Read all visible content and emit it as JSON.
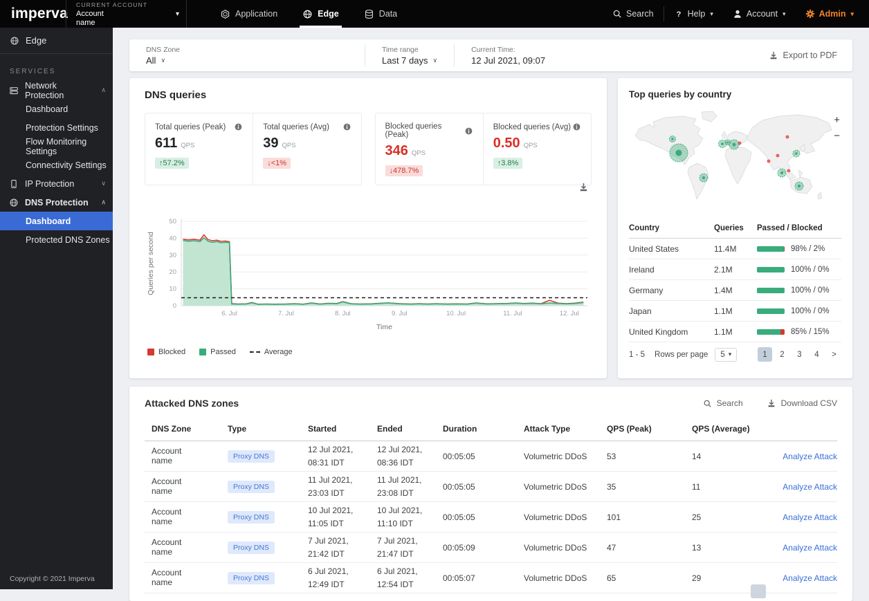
{
  "topbar": {
    "logo": "imperva",
    "current_account_label": "CURRENT ACCOUNT",
    "account_name": "Account name",
    "tabs": [
      {
        "label": "Application",
        "icon": "application",
        "active": false
      },
      {
        "label": "Edge",
        "icon": "edge",
        "active": true
      },
      {
        "label": "Data",
        "icon": "data",
        "active": false
      }
    ],
    "search_label": "Search",
    "help_label": "Help",
    "account_label": "Account",
    "admin_label": "Admin",
    "admin_color": "#f0832a"
  },
  "sidebar": {
    "product_label": "Edge",
    "services_label": "SERVICES",
    "items": [
      {
        "label": "Network Protection",
        "icon": "network",
        "expanded": true,
        "bold": false,
        "children": [
          {
            "label": "Dashboard",
            "active": false
          },
          {
            "label": "Protection Settings",
            "active": false
          },
          {
            "label": "Flow Monitoring Settings",
            "active": false
          },
          {
            "label": "Connectivity Settings",
            "active": false
          }
        ]
      },
      {
        "label": "IP Protection",
        "icon": "phone",
        "expanded": false,
        "bold": false,
        "children": []
      },
      {
        "label": "DNS Protection",
        "icon": "globe",
        "expanded": true,
        "bold": true,
        "children": [
          {
            "label": "Dashboard",
            "active": true
          },
          {
            "label": "Protected DNS Zones",
            "active": false
          }
        ]
      }
    ],
    "active_color": "#3a6bd4",
    "copyright": "Copyright © 2021 Imperva"
  },
  "filters": {
    "dns_zone_label": "DNS Zone",
    "dns_zone_value": "All",
    "time_range_label": "Time range",
    "time_range_value": "Last 7 days",
    "current_time_label": "Current Time:",
    "current_time_value": "12 Jul 2021, 09:07",
    "export_label": "Export to PDF"
  },
  "dns_queries": {
    "title": "DNS queries",
    "stat_groups": [
      [
        {
          "label": "Total queries (Peak)",
          "value": "611",
          "unit": "QPS",
          "value_color": "#212326",
          "badge": "↑57.2%",
          "badge_type": "green"
        },
        {
          "label": "Total queries (Avg)",
          "value": "39",
          "unit": "QPS",
          "value_color": "#212326",
          "badge": "↓<1%",
          "badge_type": "red"
        }
      ],
      [
        {
          "label": "Blocked queries (Peak)",
          "value": "346",
          "unit": "QPS",
          "value_color": "#d92f25",
          "badge": "↓478.7%",
          "badge_type": "red"
        },
        {
          "label": "Blocked queries (Avg)",
          "value": "0.50",
          "unit": "QPS",
          "value_color": "#d92f25",
          "badge": "↑3.8%",
          "badge_type": "green"
        }
      ]
    ],
    "legend": [
      {
        "label": "Blocked",
        "swatch": "#d6392e"
      },
      {
        "label": "Passed",
        "swatch": "#3aac7c"
      },
      {
        "label": "Average",
        "swatch": "dashed"
      }
    ]
  },
  "chart_data": {
    "type": "area",
    "title": "DNS queries",
    "xlabel": "Time",
    "ylabel": "Queries per second",
    "ylim": [
      0,
      50
    ],
    "yticks": [
      0,
      10,
      20,
      30,
      40,
      50
    ],
    "xlim": [
      5.15,
      12.32
    ],
    "xticks": [
      {
        "pos": 6,
        "label": "6. Jul"
      },
      {
        "pos": 7,
        "label": "7. Jul"
      },
      {
        "pos": 8,
        "label": "8. Jul"
      },
      {
        "pos": 9,
        "label": "9. Jul"
      },
      {
        "pos": 10,
        "label": "10. Jul"
      },
      {
        "pos": 11,
        "label": "11. Jul"
      },
      {
        "pos": 12,
        "label": "12. Jul"
      }
    ],
    "average": 4.7,
    "grid": true,
    "legend_position": "bottom",
    "series": [
      {
        "name": "Blocked",
        "color": "#d6392e",
        "points": [
          [
            5.18,
            39.4
          ],
          [
            5.28,
            39.0
          ],
          [
            5.38,
            39.3
          ],
          [
            5.48,
            38.8
          ],
          [
            5.55,
            42.0
          ],
          [
            5.62,
            39.2
          ],
          [
            5.7,
            38.5
          ],
          [
            5.78,
            38.8
          ],
          [
            5.85,
            38.1
          ],
          [
            5.93,
            38.3
          ],
          [
            6.0,
            37.9
          ],
          [
            6.04,
            1.2
          ],
          [
            6.15,
            1.0
          ],
          [
            6.3,
            1.1
          ],
          [
            6.4,
            1.9
          ],
          [
            6.5,
            0.9
          ],
          [
            6.65,
            1.0
          ],
          [
            6.8,
            0.9
          ],
          [
            7.0,
            1.0
          ],
          [
            7.15,
            1.2
          ],
          [
            7.3,
            0.9
          ],
          [
            7.45,
            1.6
          ],
          [
            7.6,
            1.0
          ],
          [
            7.75,
            1.4
          ],
          [
            7.9,
            1.3
          ],
          [
            8.0,
            2.4
          ],
          [
            8.15,
            1.2
          ],
          [
            8.3,
            1.0
          ],
          [
            8.5,
            1.1
          ],
          [
            8.65,
            1.4
          ],
          [
            8.8,
            1.7
          ],
          [
            9.0,
            1.2
          ],
          [
            9.2,
            1.0
          ],
          [
            9.35,
            1.2
          ],
          [
            9.5,
            1.0
          ],
          [
            9.65,
            1.2
          ],
          [
            9.85,
            1.0
          ],
          [
            10.0,
            1.1
          ],
          [
            10.2,
            1.0
          ],
          [
            10.35,
            1.6
          ],
          [
            10.55,
            1.1
          ],
          [
            10.7,
            1.2
          ],
          [
            10.9,
            1.3
          ],
          [
            11.05,
            1.6
          ],
          [
            11.2,
            1.3
          ],
          [
            11.35,
            1.5
          ],
          [
            11.5,
            1.2
          ],
          [
            11.65,
            3.2
          ],
          [
            11.8,
            1.5
          ],
          [
            11.95,
            1.2
          ],
          [
            12.1,
            1.5
          ],
          [
            12.25,
            2.1
          ]
        ]
      },
      {
        "name": "Passed",
        "color": "#3aac7c",
        "fill": "#c2e5d2",
        "points": [
          [
            5.18,
            38.6
          ],
          [
            5.28,
            38.2
          ],
          [
            5.38,
            38.5
          ],
          [
            5.48,
            37.9
          ],
          [
            5.55,
            40.3
          ],
          [
            5.62,
            38.2
          ],
          [
            5.7,
            37.6
          ],
          [
            5.78,
            38.0
          ],
          [
            5.85,
            37.3
          ],
          [
            5.93,
            37.6
          ],
          [
            6.0,
            37.4
          ],
          [
            6.04,
            1.0
          ],
          [
            6.15,
            0.9
          ],
          [
            6.3,
            1.0
          ],
          [
            6.4,
            1.7
          ],
          [
            6.5,
            0.8
          ],
          [
            6.65,
            0.9
          ],
          [
            6.8,
            0.8
          ],
          [
            7.0,
            0.9
          ],
          [
            7.15,
            1.1
          ],
          [
            7.3,
            0.8
          ],
          [
            7.45,
            1.5
          ],
          [
            7.6,
            0.9
          ],
          [
            7.75,
            1.3
          ],
          [
            7.9,
            1.2
          ],
          [
            8.0,
            2.2
          ],
          [
            8.15,
            1.1
          ],
          [
            8.3,
            0.9
          ],
          [
            8.5,
            1.0
          ],
          [
            8.65,
            1.3
          ],
          [
            8.8,
            1.6
          ],
          [
            9.0,
            1.1
          ],
          [
            9.2,
            0.9
          ],
          [
            9.35,
            1.1
          ],
          [
            9.5,
            0.9
          ],
          [
            9.65,
            1.1
          ],
          [
            9.85,
            0.9
          ],
          [
            10.0,
            1.0
          ],
          [
            10.2,
            0.9
          ],
          [
            10.35,
            1.5
          ],
          [
            10.55,
            1.0
          ],
          [
            10.7,
            1.1
          ],
          [
            10.9,
            1.2
          ],
          [
            11.05,
            1.5
          ],
          [
            11.2,
            1.2
          ],
          [
            11.35,
            1.4
          ],
          [
            11.5,
            1.1
          ],
          [
            11.65,
            1.6
          ],
          [
            11.8,
            1.3
          ],
          [
            11.95,
            1.1
          ],
          [
            12.1,
            1.3
          ],
          [
            12.25,
            1.9
          ]
        ]
      }
    ]
  },
  "top_countries": {
    "title": "Top queries by country",
    "map": {
      "zoom_in": "+",
      "zoom_out": "−",
      "passed_color": "#3daa7b",
      "blocked_color": "#e25549",
      "bubbles": [
        {
          "country": "Canada",
          "x": 62,
          "y": 43,
          "r": 4.5,
          "type": "passed"
        },
        {
          "country": "United States",
          "x": 71,
          "y": 63,
          "r": 13,
          "type": "passed"
        },
        {
          "country": "Brazil",
          "x": 107,
          "y": 99,
          "r": 6,
          "type": "passed"
        },
        {
          "country": "Ireland",
          "x": 134,
          "y": 50,
          "r": 5.5,
          "type": "passed"
        },
        {
          "country": "United Kingdom",
          "x": 142,
          "y": 48,
          "r": 4,
          "type": "passed"
        },
        {
          "country": "Germany",
          "x": 151,
          "y": 51,
          "r": 7,
          "type": "passed"
        },
        {
          "country": "Poland",
          "x": 159,
          "y": 49,
          "r": 2.5,
          "type": "blocked"
        },
        {
          "country": "Russia",
          "x": 228,
          "y": 40,
          "r": 2.5,
          "type": "blocked"
        },
        {
          "country": "China",
          "x": 214,
          "y": 67,
          "r": 2.5,
          "type": "blocked"
        },
        {
          "country": "India",
          "x": 201,
          "y": 75,
          "r": 2.5,
          "type": "blocked"
        },
        {
          "country": "Japan",
          "x": 241,
          "y": 64,
          "r": 5,
          "type": "passed"
        },
        {
          "country": "Philippines",
          "x": 230,
          "y": 89,
          "r": 2.5,
          "type": "blocked"
        },
        {
          "country": "Malaysia",
          "x": 220,
          "y": 92,
          "r": 6,
          "type": "passed"
        },
        {
          "country": "Australia",
          "x": 245,
          "y": 111,
          "r": 6,
          "type": "passed"
        }
      ]
    },
    "table": {
      "headers": [
        "Country",
        "Queries",
        "Passed / Blocked"
      ],
      "rows": [
        {
          "country": "United States",
          "queries": "11.4M",
          "passed_pct": 98,
          "blocked_pct": 2,
          "label": "98% / 2%"
        },
        {
          "country": "Ireland",
          "queries": "2.1M",
          "passed_pct": 100,
          "blocked_pct": 0,
          "label": "100% / 0%"
        },
        {
          "country": "Germany",
          "queries": "1.4M",
          "passed_pct": 100,
          "blocked_pct": 0,
          "label": "100% / 0%"
        },
        {
          "country": "Japan",
          "queries": "1.1M",
          "passed_pct": 100,
          "blocked_pct": 0,
          "label": "100% / 0%"
        },
        {
          "country": "United Kingdom",
          "queries": "1.1M",
          "passed_pct": 85,
          "blocked_pct": 15,
          "label": "85% / 15%"
        }
      ]
    },
    "pagination": {
      "range": "1 - 5",
      "rows_label": "Rows per page",
      "rows_value": "5",
      "pages": [
        "1",
        "2",
        "3",
        "4"
      ],
      "active_page": "1",
      "next": ">"
    }
  },
  "attacked_zones": {
    "title": "Attacked DNS zones",
    "search_label": "Search",
    "download_label": "Download CSV",
    "headers": [
      "DNS Zone",
      "Type",
      "Started",
      "Ended",
      "Duration",
      "Attack Type",
      "QPS (Peak)",
      "QPS (Average)",
      ""
    ],
    "rows": [
      {
        "zone": "Account name",
        "type": "Proxy DNS",
        "started_date": "12 Jul 2021,",
        "started_time": "08:31 IDT",
        "ended_date": "12 Jul 2021,",
        "ended_time": "08:36 IDT",
        "duration": "00:05:05",
        "attack_type": "Volumetric DDoS",
        "qps_peak": "53",
        "qps_avg": "14",
        "action": "Analyze Attack"
      },
      {
        "zone": "Account name",
        "type": "Proxy DNS",
        "started_date": "11 Jul 2021,",
        "started_time": "23:03 IDT",
        "ended_date": "11 Jul 2021,",
        "ended_time": "23:08 IDT",
        "duration": "00:05:05",
        "attack_type": "Volumetric DDoS",
        "qps_peak": "35",
        "qps_avg": "11",
        "action": "Analyze Attack"
      },
      {
        "zone": "Account name",
        "type": "Proxy DNS",
        "started_date": "10 Jul 2021,",
        "started_time": "11:05 IDT",
        "ended_date": "10 Jul 2021,",
        "ended_time": "11:10 IDT",
        "duration": "00:05:05",
        "attack_type": "Volumetric DDoS",
        "qps_peak": "101",
        "qps_avg": "25",
        "action": "Analyze Attack"
      },
      {
        "zone": "Account name",
        "type": "Proxy DNS",
        "started_date": "7 Jul 2021,",
        "started_time": "21:42 IDT",
        "ended_date": "7 Jul 2021,",
        "ended_time": "21:47 IDT",
        "duration": "00:05:09",
        "attack_type": "Volumetric DDoS",
        "qps_peak": "47",
        "qps_avg": "13",
        "action": "Analyze Attack"
      },
      {
        "zone": "Account name",
        "type": "Proxy DNS",
        "started_date": "6 Jul 2021,",
        "started_time": "12:49 IDT",
        "ended_date": "6 Jul 2021,",
        "ended_time": "12:54 IDT",
        "duration": "00:05:07",
        "attack_type": "Volumetric DDoS",
        "qps_peak": "65",
        "qps_avg": "29",
        "action": "Analyze Attack"
      }
    ]
  }
}
